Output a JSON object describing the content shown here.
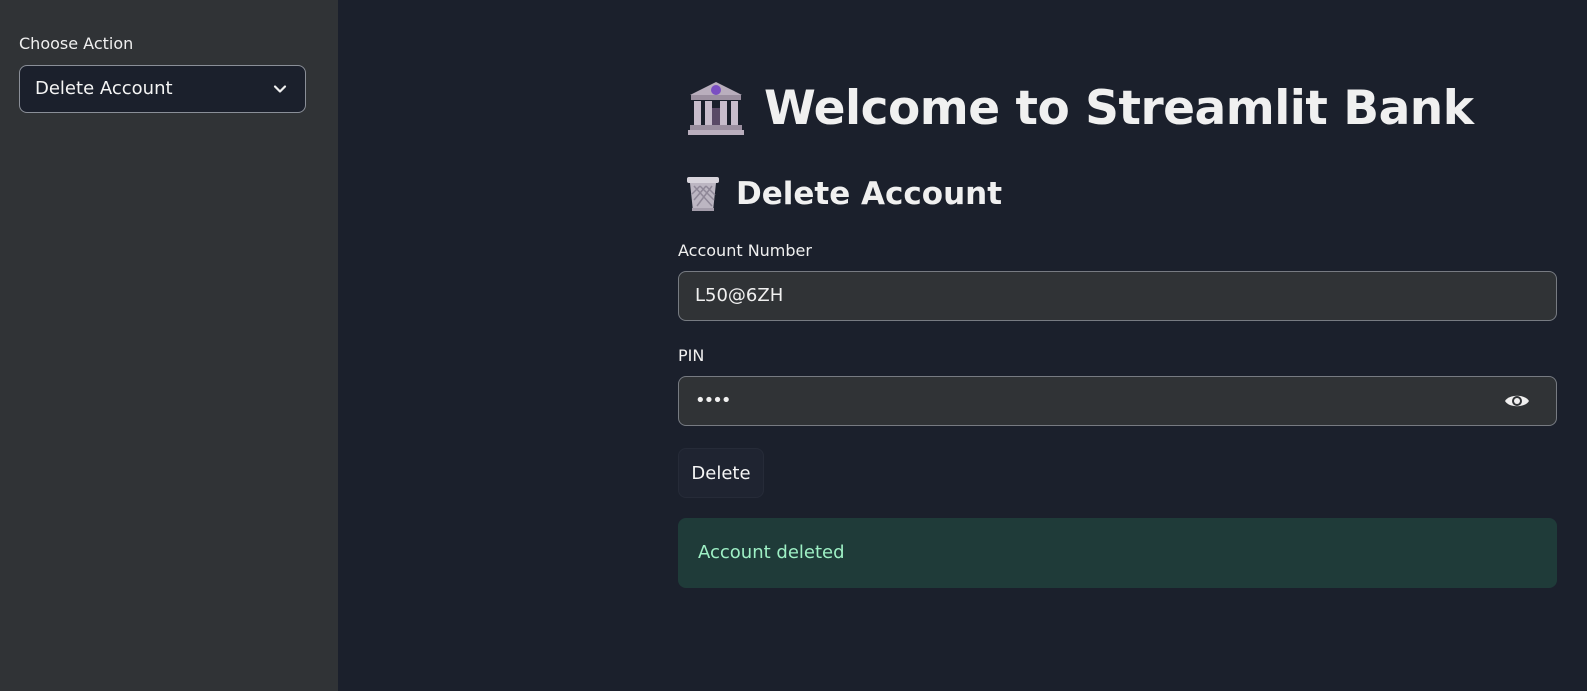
{
  "sidebar": {
    "label": "Choose Action",
    "select": {
      "value": "Delete Account",
      "icon": "chevron-down-icon"
    }
  },
  "main": {
    "title": "Welcome to Streamlit Bank",
    "title_icon": "bank-icon",
    "subtitle": "Delete Account",
    "subtitle_icon": "wastebasket-icon",
    "fields": {
      "account_number": {
        "label": "Account Number",
        "value": "L50@6ZH"
      },
      "pin": {
        "label": "PIN",
        "value": "••••",
        "icon": "eye-icon"
      }
    },
    "button": {
      "label": "Delete"
    },
    "alert": {
      "text": "Account deleted"
    }
  },
  "colors": {
    "sidebar_bg": "#303336",
    "main_bg": "#1b202c",
    "input_bg": "#303336",
    "success_bg": "#1f3b39",
    "success_text": "#9ef0c5"
  }
}
